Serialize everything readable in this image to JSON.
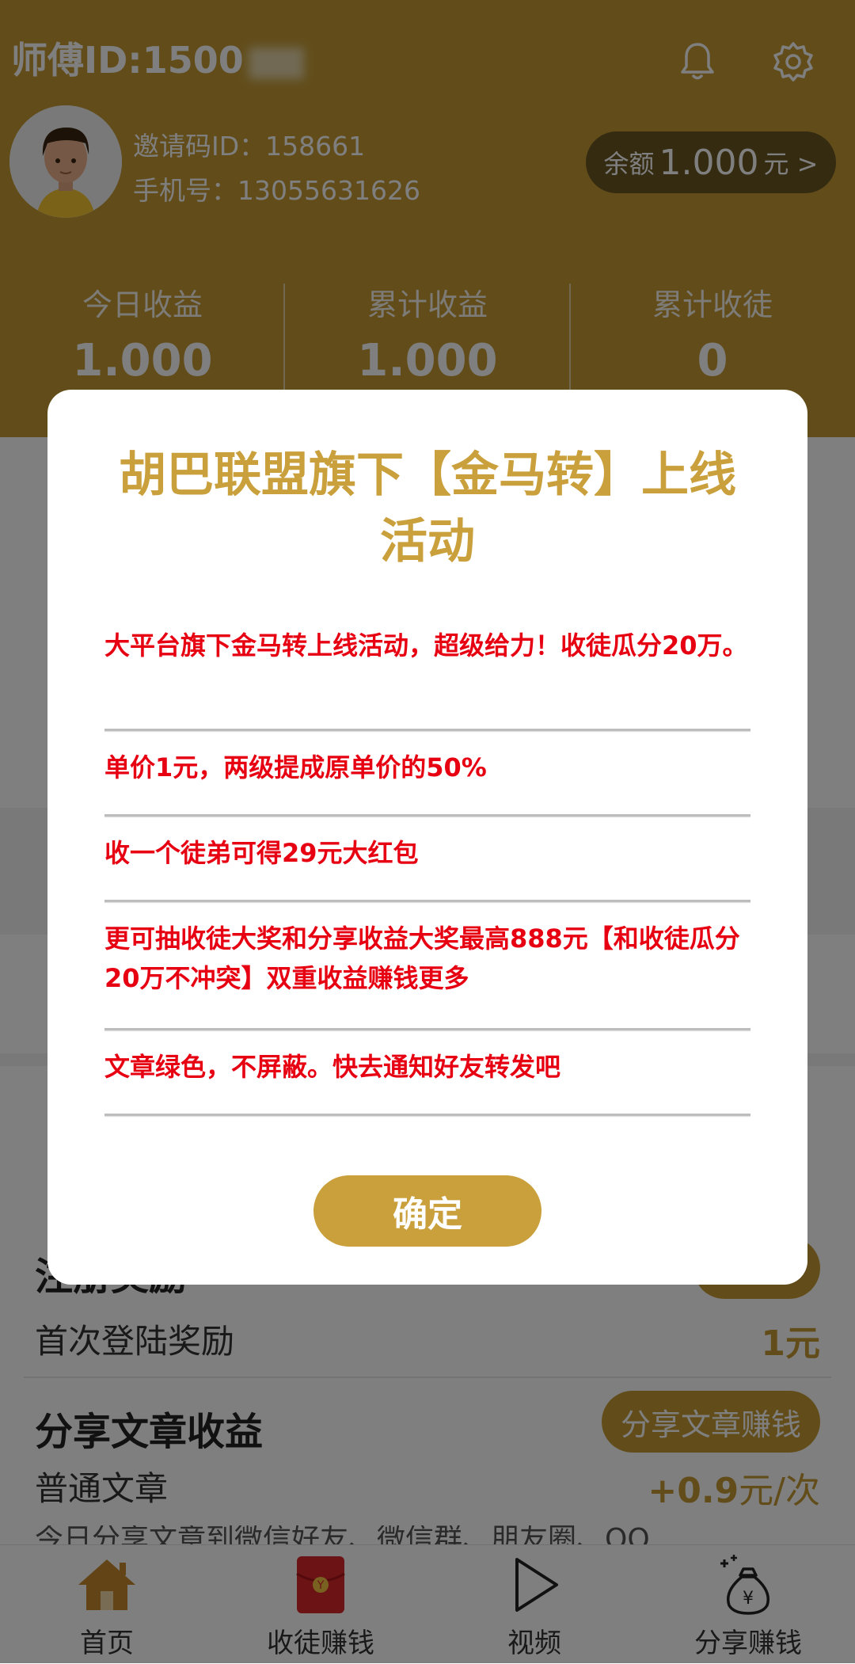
{
  "header": {
    "master_id": "师傅ID:1500",
    "invite_code": "邀请码ID：158661",
    "phone": "手机号：13055631626",
    "balance_prefix": "余额",
    "balance_value": "1.000",
    "balance_suffix": "元 >",
    "bg_color": "#c49a35"
  },
  "stats": [
    {
      "label": "今日收益",
      "value": "1.000"
    },
    {
      "label": "累计收益",
      "value": "1.000"
    },
    {
      "label": "累计收徒",
      "value": "0"
    }
  ],
  "background": {
    "row1_title": "注册奖励",
    "row1_sub": "首次登陆奖励",
    "row1_value": "1元",
    "row2_title": "分享文章收益",
    "row2_button": "分享文章赚钱",
    "row2_sub": "普通文章",
    "row2_value_num": "+0.9",
    "row2_value_unit": "元/次",
    "row3_text": "今日分享文章到微信好友、微信群、朋友圈、QQ..."
  },
  "dialog": {
    "title": "胡巴联盟旗下【金马转】上线活动",
    "items": [
      "大平台旗下金马转上线活动，超级给力！收徒瓜分20万。",
      "单价1元，两级提成原单价的50%",
      "收一个徒弟可得29元大红包",
      "更可抽收徒大奖和分享收益大奖最高888元【和收徒瓜分20万不冲突】双重收益赚钱更多",
      "文章绿色，不屏蔽。快去通知好友转发吧"
    ],
    "confirm_label": "确定",
    "accent_color": "#c9a03c",
    "item_color": "#e60012"
  },
  "tabbar": [
    {
      "label": "首页",
      "icon": "home-icon"
    },
    {
      "label": "收徒赚钱",
      "icon": "red-envelope-icon"
    },
    {
      "label": "视频",
      "icon": "play-icon"
    },
    {
      "label": "分享赚钱",
      "icon": "money-bag-icon"
    }
  ]
}
